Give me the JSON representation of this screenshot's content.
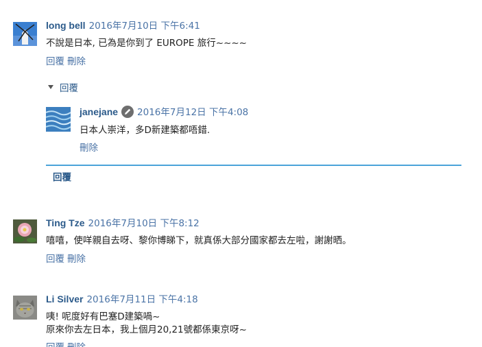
{
  "comments": [
    {
      "author": "long bell",
      "timestamp": "2016年7月10日 下午6:41",
      "text_lines": [
        "不說是日本, 已為是你到了 EUROPE 旅行~~~~"
      ],
      "reply_label": "回覆",
      "delete_label": "刪除",
      "avatar": "windmill"
    },
    {
      "author": "Ting Tze",
      "timestamp": "2016年7月10日 下午8:12",
      "text_lines": [
        "嘻嘻，使咩親自去呀、黎你博睇下，就真係大部分國家都去左啦，謝謝晒。"
      ],
      "reply_label": "回覆",
      "delete_label": "刪除",
      "avatar": "lotus"
    },
    {
      "author": "Li Silver",
      "timestamp": "2016年7月11日 下午4:18",
      "text_lines": [
        "咦! 呢度好有巴塞D建築喎~",
        "原來你去左日本，我上個月20,21號都係東京呀~"
      ],
      "reply_label": "回覆",
      "delete_label": "刪除",
      "avatar": "cat"
    }
  ],
  "thread": {
    "toggle_label": "回覆",
    "reply": {
      "author": "janejane",
      "author_badge_icon": "pencil-icon",
      "timestamp": "2016年7月12日 下午4:08",
      "text": "日本人崇洋，多D新建築都唔錯.",
      "delete_label": "刪除",
      "avatar": "water"
    },
    "reply_box_label": "回覆"
  },
  "colors": {
    "author": "#2b5a8a",
    "link": "#4a73a6",
    "reply_box_border": "#4aa3d9"
  }
}
